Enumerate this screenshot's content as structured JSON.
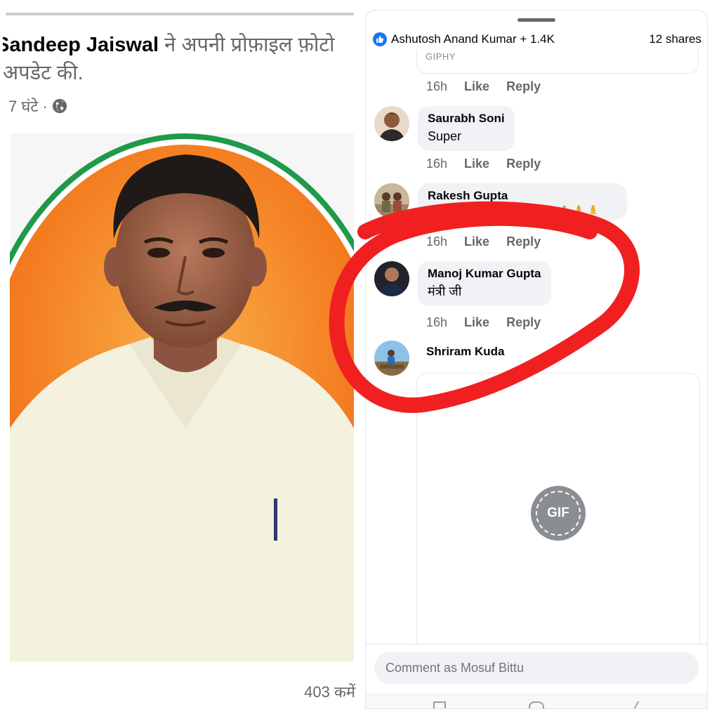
{
  "left": {
    "post_author": "Sandeep Jaiswal",
    "post_action_line1": " ने अपनी प्रोफ़ाइल फ़ोटो",
    "post_action_line2": "अपडेट की.",
    "post_time": "7 घंटे ·",
    "comment_count": "403 कमें"
  },
  "right": {
    "reactions_summary": "Ashutosh Anand Kumar + 1.4K",
    "shares": "12 shares",
    "giphy_label": "GIPHY",
    "action_time": "16h",
    "action_like": "Like",
    "action_reply": "Reply",
    "comments": [
      {
        "name": "Saurabh Soni",
        "text": "Super"
      },
      {
        "name": "Rakesh Gupta",
        "text": "🙏🙏🙏🙏🙏🙏🙏🙏🙏🙏🙏🙏"
      },
      {
        "name": "Manoj Kumar Gupta",
        "text": "मंत्री जी"
      }
    ],
    "partial_commenter": "Shriram Kuda",
    "gif_label": "GIF",
    "composer_placeholder": "Comment as Mosuf Bittu"
  },
  "colors": {
    "accent": "#1877f2",
    "annotation": "#f02020",
    "saffron": "#f47c20",
    "green": "#1e9a4a"
  }
}
